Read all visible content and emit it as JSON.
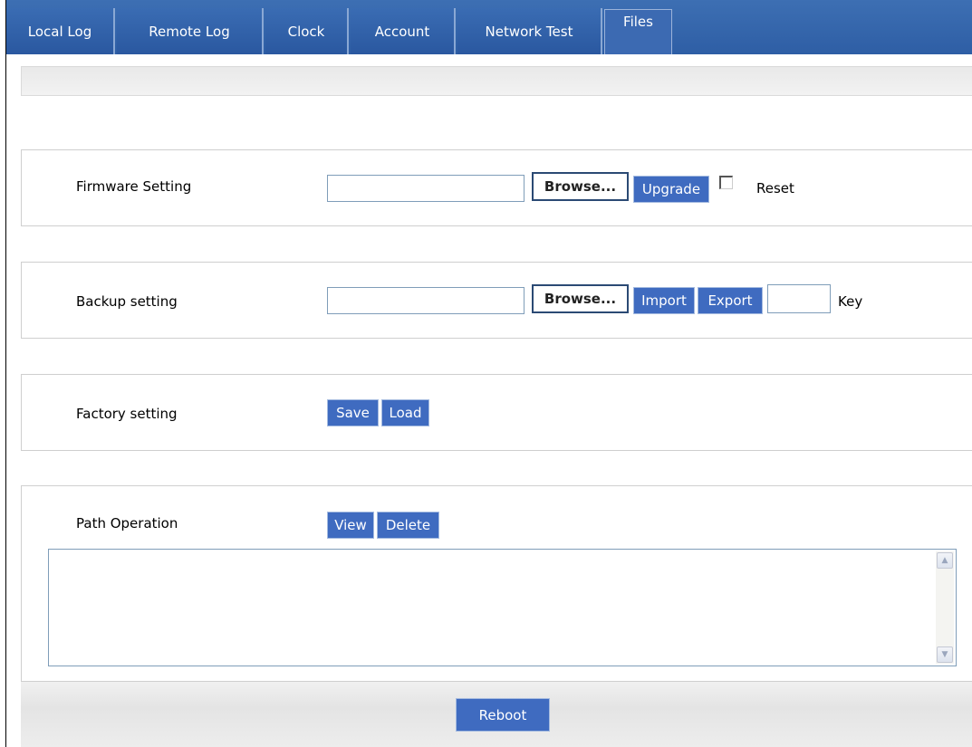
{
  "tabs": [
    {
      "label": "Local Log"
    },
    {
      "label": "Remote Log"
    },
    {
      "label": "Clock"
    },
    {
      "label": "Account"
    },
    {
      "label": "Network Test"
    },
    {
      "label": "Files"
    }
  ],
  "active_tab": "Files",
  "firmware": {
    "label": "Firmware Setting",
    "file_value": "",
    "browse_label": "Browse...",
    "upgrade_label": "Upgrade",
    "reset_label": "Reset",
    "reset_checked": false
  },
  "backup": {
    "label": "Backup setting",
    "file_value": "",
    "browse_label": "Browse...",
    "import_label": "Import",
    "export_label": "Export",
    "key_value": "",
    "key_label": "Key"
  },
  "factory": {
    "label": "Factory setting",
    "save_label": "Save",
    "load_label": "Load"
  },
  "path": {
    "label": "Path Operation",
    "view_label": "View",
    "delete_label": "Delete",
    "output_text": ""
  },
  "footer": {
    "reboot_label": "Reboot"
  },
  "colors": {
    "tab_bg": "#2e5ea5",
    "button_bg": "#3f6bc0",
    "browse_border": "#2b4a74"
  },
  "icons": {
    "scroll_up": "scroll-up-arrow-icon",
    "scroll_down": "scroll-down-arrow-icon"
  }
}
